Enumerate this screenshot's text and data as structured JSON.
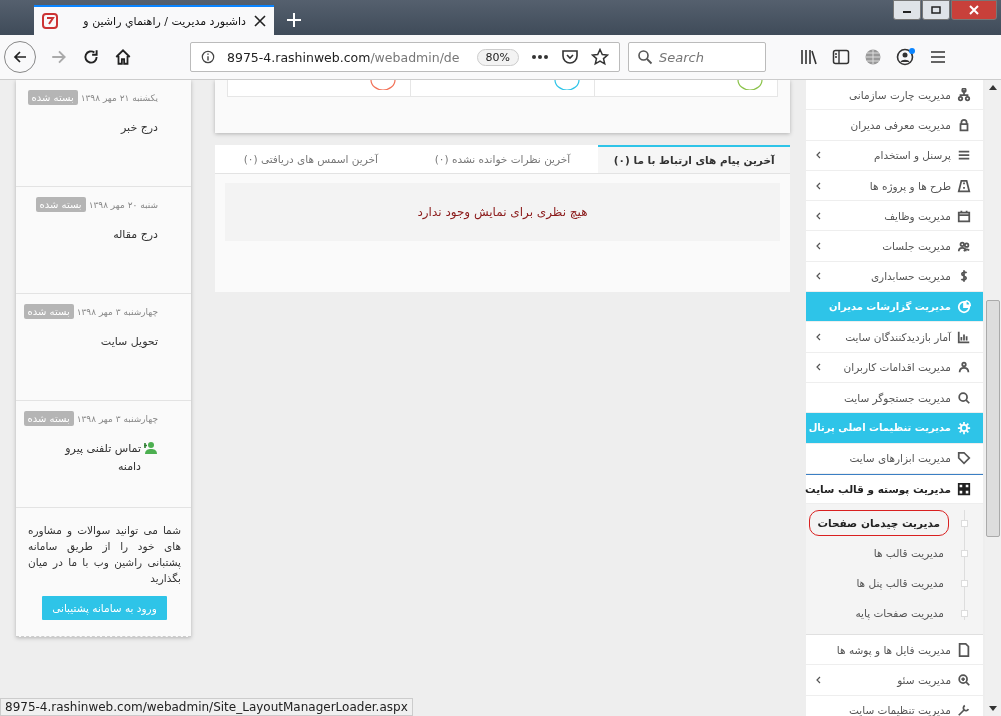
{
  "browser": {
    "tab_title": "داشبورد مدیریت / راهنماي راشين و",
    "url_host": "8975-4.rashinweb.com",
    "url_path": "/webadmin/de",
    "zoom": "80%",
    "search": {
      "placeholder": "Search"
    }
  },
  "tasks": [
    {
      "status": "بسته شده",
      "date": "یکشنبه ۲۱ مهر ۱۳۹۸",
      "title": "درج خبر",
      "kind": "plain"
    },
    {
      "status": "بسته شده",
      "date": "شنبه ۲۰ مهر ۱۳۹۸",
      "title": "درج مقاله",
      "kind": "plain"
    },
    {
      "status": "بسته شده",
      "date": "چهارشنبه ۳ مهر ۱۳۹۸",
      "title": "تحویل سایت",
      "kind": "plain"
    },
    {
      "status": "بسته شده",
      "date": "چهارشنبه ۳ مهر ۱۳۹۸",
      "title": "تماس تلفنی پیرو دامنه",
      "kind": "contact"
    }
  ],
  "support": {
    "text": "شما می توانید سوالات و مشاوره های خود را از طریق سامانه پشتبانی راشین وب با ما در میان بگذارید",
    "button": "ورود به سامانه پشتیبانی"
  },
  "tabs": [
    {
      "label": "آخرین پیام های ارتباط با ما (۰)",
      "selected": true
    },
    {
      "label": "آخرین نظرات خوانده نشده (۰)",
      "selected": false
    },
    {
      "label": "آخرین اسمس های دریافتی (۰)",
      "selected": false
    }
  ],
  "empty_message": "هیچ نظری برای نمایش وجود ندارد",
  "menu": [
    {
      "label": "مدیریت چارت سازمانی",
      "has_submenu": false,
      "highlighted": false,
      "expanded": false
    },
    {
      "label": "مدیریت معرفی مدیران",
      "has_submenu": false,
      "highlighted": false,
      "expanded": false
    },
    {
      "label": "پرسنل و استخدام",
      "has_submenu": true,
      "highlighted": false,
      "expanded": false
    },
    {
      "label": "طرح ها و پروژه ها",
      "has_submenu": true,
      "highlighted": false,
      "expanded": false
    },
    {
      "label": "مدیریت وظایف",
      "has_submenu": true,
      "highlighted": false,
      "expanded": false
    },
    {
      "label": "مدیریت جلسات",
      "has_submenu": true,
      "highlighted": false,
      "expanded": false
    },
    {
      "label": "مدیریت حسابداری",
      "has_submenu": true,
      "highlighted": false,
      "expanded": false
    },
    {
      "label": "مدیریت گزارشات مدیران",
      "has_submenu": false,
      "highlighted": true,
      "expanded": false
    },
    {
      "label": "آمار بازدیدکنندگان سایت",
      "has_submenu": true,
      "highlighted": false,
      "expanded": false
    },
    {
      "label": "مدیریت اقدامات کاربران",
      "has_submenu": true,
      "highlighted": false,
      "expanded": false
    },
    {
      "label": "مدیریت جستجوگر سایت",
      "has_submenu": false,
      "highlighted": false,
      "expanded": false
    },
    {
      "label": "مدیریت تنظیمات اصلی پرتال",
      "has_submenu": false,
      "highlighted": true,
      "expanded": false
    },
    {
      "label": "مدیریت ابزارهای سایت",
      "has_submenu": false,
      "highlighted": false,
      "expanded": false
    },
    {
      "label": "مدیریت پوسته و قالب سایت",
      "has_submenu": false,
      "highlighted": false,
      "expanded": true,
      "children": [
        {
          "label": "مدیریت چیدمان صفحات",
          "circled": true
        },
        {
          "label": "مدیریت قالب ها",
          "circled": false
        },
        {
          "label": "مدیریت قالب پنل ها",
          "circled": false
        },
        {
          "label": "مدیریت صفحات پایه",
          "circled": false
        }
      ]
    },
    {
      "label": "مدیریت فایل ها و پوشه ها",
      "has_submenu": false,
      "highlighted": false,
      "expanded": false
    },
    {
      "label": "مدیریت سئو",
      "has_submenu": true,
      "highlighted": false,
      "expanded": false
    },
    {
      "label": "مدیریت تنظیمات سایت",
      "has_submenu": false,
      "highlighted": false,
      "expanded": false
    }
  ],
  "status_bar": "8975-4.rashinweb.com/webadmin/Site_LayoutManagerLoader.aspx"
}
